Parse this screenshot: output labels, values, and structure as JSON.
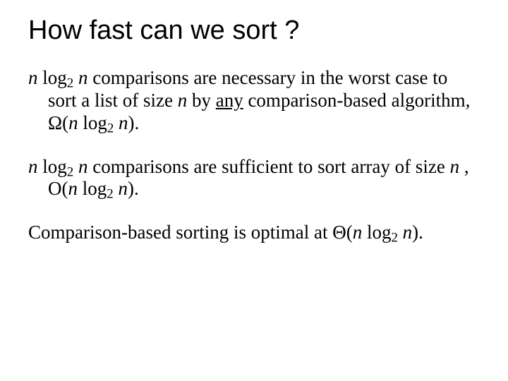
{
  "title": "How fast can we sort ?",
  "p1": {
    "a": "n",
    "b": " log",
    "c": "2",
    "d": " n",
    "e": "  comparisons are necessary in the worst case to sort a list of size ",
    "f": "n",
    "g": " by ",
    "h": "any",
    "i": " comparison-based algorithm, Ω(",
    "j": "n",
    "k": " log",
    "l": "2",
    "m": " n",
    "n": ")."
  },
  "p2": {
    "a": "n",
    "b": " log",
    "c": "2",
    "d": " n",
    "e": " comparisons are sufficient to sort array of size ",
    "f": "n",
    "g": " , O(",
    "h": "n",
    "i": " log",
    "j": "2",
    "k": " n",
    "l": ")."
  },
  "p3": {
    "a": "Comparison-based sorting is optimal at Θ(",
    "b": "n",
    "c": " log",
    "d": "2",
    "e": " n",
    "f": ")."
  }
}
